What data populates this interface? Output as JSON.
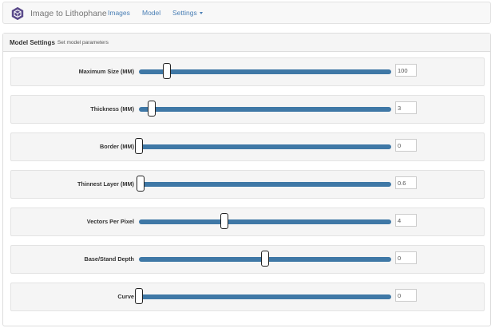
{
  "navbar": {
    "brand_icon": "cube-logo-icon",
    "brand": "Image to Lithophane",
    "links": [
      "Images",
      "Model"
    ],
    "dropdown_label": "Settings",
    "dropdown_icon": "caret-down-icon"
  },
  "panel": {
    "title": "Model Settings",
    "subtitle": "Set model parameters"
  },
  "settings": [
    {
      "label": "Maximum Size (MM)",
      "value": "100",
      "slider_fraction": 0.11
    },
    {
      "label": "Thickness (MM)",
      "value": "3",
      "slider_fraction": 0.05
    },
    {
      "label": "Border (MM)",
      "value": "0",
      "slider_fraction": 0.0
    },
    {
      "label": "Thinnest Layer (MM)",
      "value": "0.6",
      "slider_fraction": 0.005
    },
    {
      "label": "Vectors Per Pixel",
      "value": "4",
      "slider_fraction": 0.34
    },
    {
      "label": "Base/Stand Depth",
      "value": "0",
      "slider_fraction": 0.5
    },
    {
      "label": "Curve",
      "value": "0",
      "slider_fraction": 0.0
    }
  ],
  "colors": {
    "link": "#4a7fb5",
    "slider_track": "#3f78a6",
    "logo": "#5a4a8a"
  }
}
